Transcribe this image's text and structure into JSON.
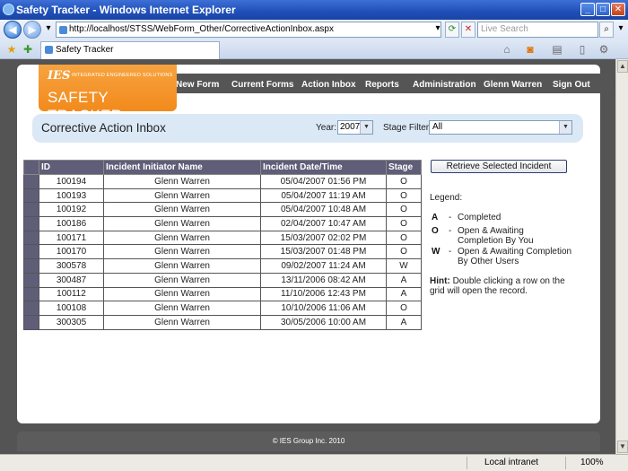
{
  "window": {
    "title": "Safety Tracker - Windows Internet Explorer"
  },
  "browser": {
    "url": "http://localhost/STSS/WebForm_Other/CorrectiveActionInbox.aspx",
    "search_placeholder": "Live Search",
    "tab_title": "Safety Tracker"
  },
  "logo": {
    "ies": "IES",
    "sub": "INTEGRATED ENGINEERED SOLUTIONS",
    "name": "SAFETY TRACKER"
  },
  "nav": [
    "New Form",
    "Current Forms",
    "Action Inbox",
    "Reports",
    "Administration",
    "Glenn Warren",
    "Sign Out"
  ],
  "header": {
    "title": "Corrective Action Inbox",
    "year_label": "Year:",
    "year_value": "2007",
    "stage_label": "Stage Filter:",
    "stage_value": "All"
  },
  "grid": {
    "columns": [
      "ID",
      "Incident Initiator Name",
      "Incident Date/Time",
      "Stage"
    ],
    "rows": [
      [
        "100194",
        "Glenn Warren",
        "05/04/2007 01:56 PM",
        "O"
      ],
      [
        "100193",
        "Glenn Warren",
        "05/04/2007 11:19 AM",
        "O"
      ],
      [
        "100192",
        "Glenn Warren",
        "05/04/2007 10:48 AM",
        "O"
      ],
      [
        "100186",
        "Glenn Warren",
        "02/04/2007 10:47 AM",
        "O"
      ],
      [
        "100171",
        "Glenn Warren",
        "15/03/2007 02:02 PM",
        "O"
      ],
      [
        "100170",
        "Glenn Warren",
        "15/03/2007 01:48 PM",
        "O"
      ],
      [
        "300578",
        "Glenn Warren",
        "09/02/2007 11:24 AM",
        "W"
      ],
      [
        "300487",
        "Glenn Warren",
        "13/11/2006 08:42 AM",
        "A"
      ],
      [
        "100112",
        "Glenn Warren",
        "11/10/2006 12:43 PM",
        "A"
      ],
      [
        "100108",
        "Glenn Warren",
        "10/10/2006 11:06 AM",
        "O"
      ],
      [
        "300305",
        "Glenn Warren",
        "30/05/2006 10:00 AM",
        "A"
      ]
    ]
  },
  "retrieve_label": "Retrieve Selected Incident",
  "legend": {
    "title": "Legend:",
    "items": [
      {
        "key": "A",
        "dash": "-",
        "text": "Completed"
      },
      {
        "key": "O",
        "dash": "-",
        "text": "Open & Awaiting Completion By You"
      },
      {
        "key": "W",
        "dash": "-",
        "text": "Open & Awaiting Completion By Other Users"
      }
    ]
  },
  "hint": {
    "label": "Hint:",
    "text": "Double clicking a row on the grid will open the record."
  },
  "footer": "© IES Group Inc. 2010",
  "status": {
    "zone": "Local intranet",
    "zoom": "100%"
  }
}
